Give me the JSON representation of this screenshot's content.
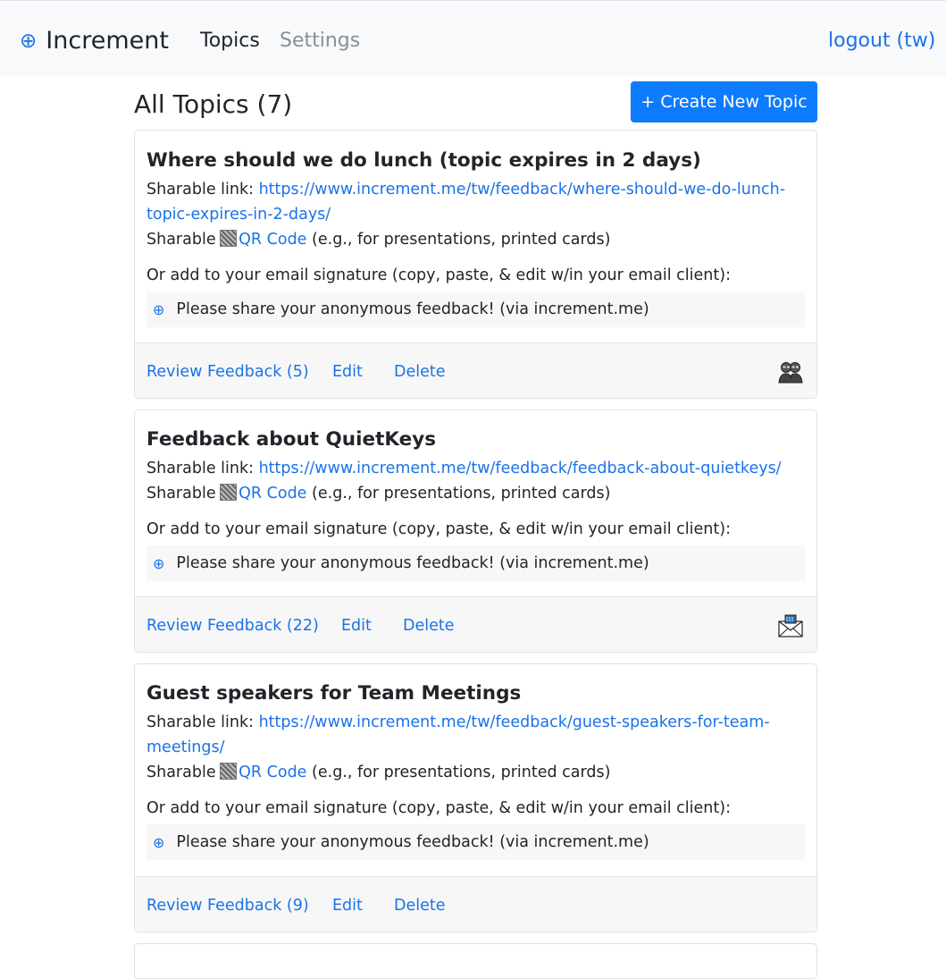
{
  "navbar": {
    "brand_icon": "⊕",
    "brand": "Increment",
    "topics": "Topics",
    "settings": "Settings",
    "logout": "logout (tw)"
  },
  "header": {
    "title": "All Topics (7)",
    "create_button": "+ Create New Topic"
  },
  "labels": {
    "sharable_link": "Sharable link: ",
    "sharable": "Sharable ",
    "qr_code": "QR Code",
    "qr_note": " (e.g., for presentations, printed cards)",
    "signature_intro": "Or add to your email signature (copy, paste, & edit w/in your email client):",
    "signature_icon": "⊕",
    "signature_text": "Please share your anonymous feedback! (via increment.me)",
    "edit": "Edit",
    "delete": "Delete"
  },
  "topics": [
    {
      "title": "Where should we do lunch (topic expires in 2 days)",
      "link_line1": "https://www.increment.me/tw/feedback/where-should-we-do-lunch-",
      "link_line2": "topic-expires-in-2-days/",
      "review": "Review Feedback (5)",
      "icon": "two-users-icon"
    },
    {
      "title": "Feedback about QuietKeys",
      "link_line1": "https://www.increment.me/tw/feedback/feedback-about-quietkeys/",
      "review": "Review Feedback (22)",
      "icon": "envelope-icon"
    },
    {
      "title": "Guest speakers for Team Meetings",
      "link_line1": "https://www.increment.me/tw/feedback/guest-speakers-for-team-",
      "link_line2": "meetings/",
      "review": "Review Feedback (9)"
    }
  ],
  "colors": {
    "primary": "#0d7bfd",
    "link": "#1a73e8",
    "navbar_bg": "#f8f9fa",
    "card_footer_bg": "#f7f7f7"
  }
}
